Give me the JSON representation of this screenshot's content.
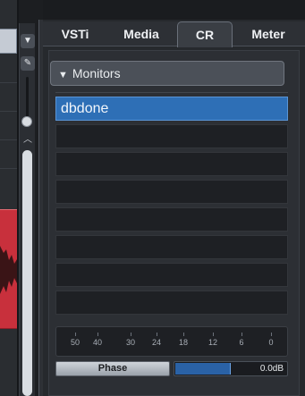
{
  "tabs": [
    {
      "label": "VSTi",
      "active": false
    },
    {
      "label": "Media",
      "active": false
    },
    {
      "label": "CR",
      "active": true
    },
    {
      "label": "Meter",
      "active": false
    }
  ],
  "monitors": {
    "header": "Monitors",
    "items": [
      "dbdone",
      "",
      "",
      "",
      "",
      "",
      "",
      ""
    ],
    "selected_index": 0
  },
  "meter_scale": {
    "labels": [
      "50",
      "40",
      "30",
      "24",
      "18",
      "12",
      "6",
      "0"
    ]
  },
  "phase": {
    "label": "Phase"
  },
  "level": {
    "value_text": "0.0dB",
    "fill_fraction": 0.5
  },
  "icons": {
    "dropdown": "triangle-down-icon",
    "edit": "pencil-icon",
    "scroll_up": "chevron-up-icon",
    "section_toggle": "triangle-down-icon"
  },
  "colors": {
    "accent": "#2e6fb6",
    "event_red": "#c8303c"
  }
}
